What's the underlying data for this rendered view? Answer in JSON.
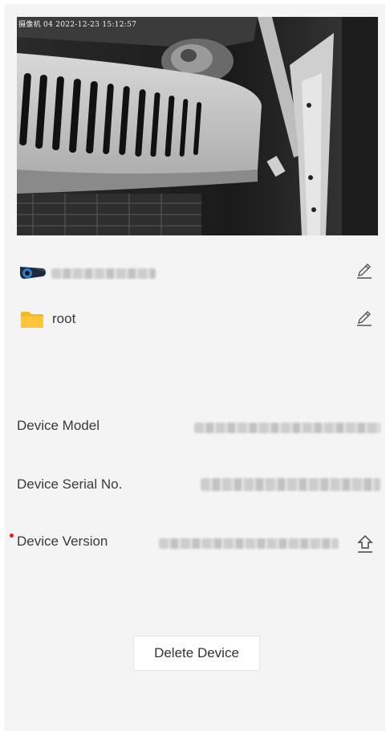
{
  "preview": {
    "osd_name": "摄像机 04",
    "osd_datetime": "2022-12-23 15:12:57"
  },
  "device": {
    "name_redacted": true,
    "folder_name": "root"
  },
  "info": {
    "model_label": "Device Model",
    "serial_label": "Device Serial No.",
    "version_label": "Device Version"
  },
  "actions": {
    "delete_label": "Delete Device"
  },
  "colors": {
    "panel_bg": "#f4f4f4",
    "folder": "#f5b829",
    "required_dot": "#e02020",
    "camera_body": "#1f2b3d",
    "camera_lens": "#2f7fd0"
  }
}
